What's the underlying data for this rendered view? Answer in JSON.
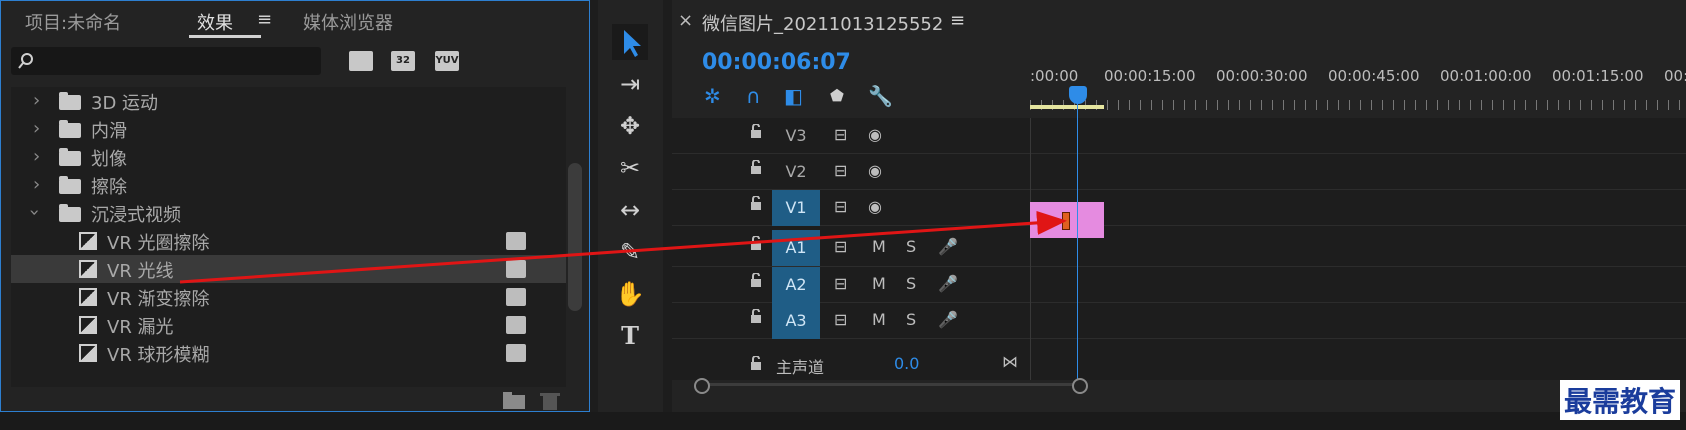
{
  "effects_panel": {
    "tabs": [
      {
        "label": "项目:未命名"
      },
      {
        "label": "效果"
      },
      {
        "label": "媒体浏览器"
      }
    ],
    "menu_icon": "≡",
    "toolbar_icons": [
      "accelerated-effects-icon",
      "32-bit-icon",
      "yuv-icon"
    ],
    "toolbar_labels": [
      "",
      "32",
      "YUV"
    ],
    "tree": [
      {
        "label": "3D 运动",
        "type": "folder",
        "expanded": false
      },
      {
        "label": "内滑",
        "type": "folder",
        "expanded": false
      },
      {
        "label": "划像",
        "type": "folder",
        "expanded": false
      },
      {
        "label": "擦除",
        "type": "folder",
        "expanded": false
      },
      {
        "label": "沉浸式视频",
        "type": "folder",
        "expanded": true
      },
      {
        "label": "VR 光圈擦除",
        "type": "effect"
      },
      {
        "label": "VR 光线",
        "type": "effect",
        "selected": true
      },
      {
        "label": "VR 渐变擦除",
        "type": "effect"
      },
      {
        "label": "VR 漏光",
        "type": "effect"
      },
      {
        "label": "VR 球形模糊",
        "type": "effect"
      }
    ]
  },
  "timeline": {
    "close": "×",
    "sequence_title": "微信图片_20211013125552",
    "menu_icon": "≡",
    "timecode": "00:00:06:07",
    "ruler_labels": [
      ":00:00",
      "00:00:15:00",
      "00:00:30:00",
      "00:00:45:00",
      "00:01:00:00",
      "00:01:15:00",
      "00:"
    ],
    "tracks": [
      {
        "name": "V3",
        "targeted": false,
        "kind": "video"
      },
      {
        "name": "V2",
        "targeted": false,
        "kind": "video"
      },
      {
        "name": "V1",
        "targeted": true,
        "kind": "video"
      },
      {
        "name": "A1",
        "targeted": true,
        "kind": "audio",
        "m": "M",
        "s": "S"
      },
      {
        "name": "A2",
        "targeted": true,
        "kind": "audio",
        "m": "M",
        "s": "S"
      },
      {
        "name": "A3",
        "targeted": true,
        "kind": "audio",
        "m": "M",
        "s": "S"
      }
    ],
    "master": {
      "label": "主声道",
      "value": "0.0"
    }
  },
  "watermark": "最需教育",
  "colors": {
    "accent": "#2e8ce8",
    "clip": "#e58be0",
    "arrow": "#e01515"
  }
}
